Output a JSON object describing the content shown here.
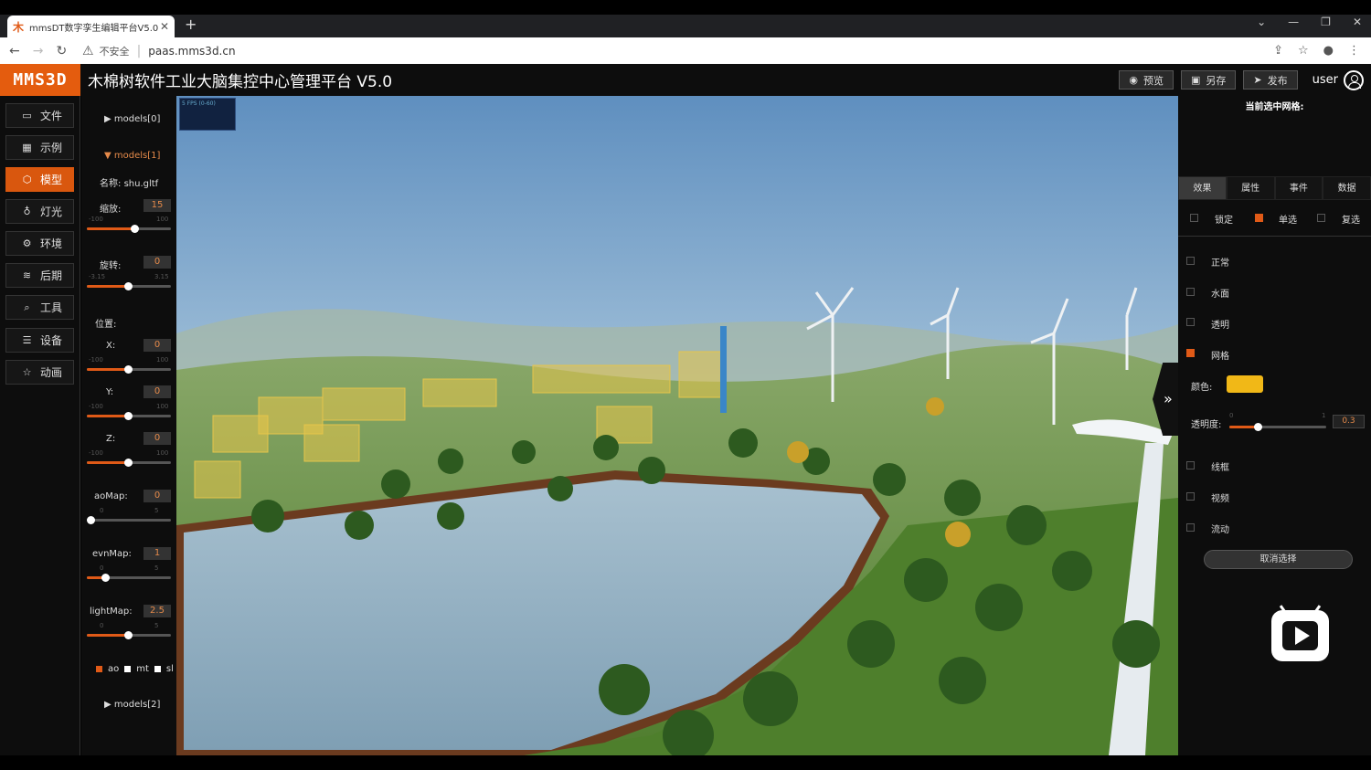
{
  "browser": {
    "tab_title": "mmsDT数字孪生编辑平台V5.0",
    "tab_favicon": "木",
    "security_label": "不安全",
    "url": "paas.mms3d.cn"
  },
  "header": {
    "logo": "MMS3D",
    "title": "木棉树软件工业大脑集控中心管理平台 V5.0",
    "preview_label": "预览",
    "saveas_label": "另存",
    "publish_label": "发布",
    "user": "user"
  },
  "nav": {
    "items": [
      {
        "label": "文件",
        "icon": "folder-icon"
      },
      {
        "label": "示例",
        "icon": "grid-icon"
      },
      {
        "label": "模型",
        "icon": "cube-icon"
      },
      {
        "label": "灯光",
        "icon": "bulb-icon"
      },
      {
        "label": "环境",
        "icon": "gear-icon"
      },
      {
        "label": "后期",
        "icon": "layers-icon"
      },
      {
        "label": "工具",
        "icon": "search-icon"
      },
      {
        "label": "设备",
        "icon": "list-icon"
      },
      {
        "label": "动画",
        "icon": "star-icon"
      }
    ],
    "active": "模型"
  },
  "models": {
    "group0": "models[0]",
    "group1": "models[1]",
    "group2": "models[2]",
    "name_label": "名称:",
    "name_value": "shu.gltf",
    "scale": {
      "label": "缩放:",
      "value": "15",
      "min": "-100",
      "max": "100"
    },
    "rotate": {
      "label": "旋转:",
      "value": "0",
      "min": "-3.15",
      "max": "3.15"
    },
    "position_label": "位置:",
    "x": {
      "label": "X:",
      "value": "0",
      "min": "-100",
      "max": "100"
    },
    "y": {
      "label": "Y:",
      "value": "0",
      "min": "-100",
      "max": "100"
    },
    "z": {
      "label": "Z:",
      "value": "0",
      "min": "-100",
      "max": "100"
    },
    "aomap": {
      "label": "aoMap:",
      "value": "0",
      "min": "0",
      "max": "5"
    },
    "envmap": {
      "label": "evnMap:",
      "value": "1",
      "min": "0",
      "max": "5"
    },
    "lightmap": {
      "label": "lightMap:",
      "value": "2.5",
      "min": "0",
      "max": "5"
    },
    "toggles": {
      "ao": "ao",
      "mt": "mt",
      "sl": "sl"
    }
  },
  "scene": {
    "fps": "5 FPS (0-60)"
  },
  "right": {
    "title": "当前选中网格:",
    "tabs": [
      "效果",
      "属性",
      "事件",
      "数据"
    ],
    "active_tab": "效果",
    "lock": "锁定",
    "single": "单选",
    "multi": "复选",
    "effects": [
      "正常",
      "水面",
      "透明",
      "网格"
    ],
    "color_label": "颜色:",
    "color": "#f1b817",
    "opacity_label": "透明度:",
    "opacity_min": "0",
    "opacity_max": "1",
    "opacity_value": "0.3",
    "effects2": [
      "线框",
      "视频",
      "流动"
    ],
    "deselect": "取消选择"
  }
}
